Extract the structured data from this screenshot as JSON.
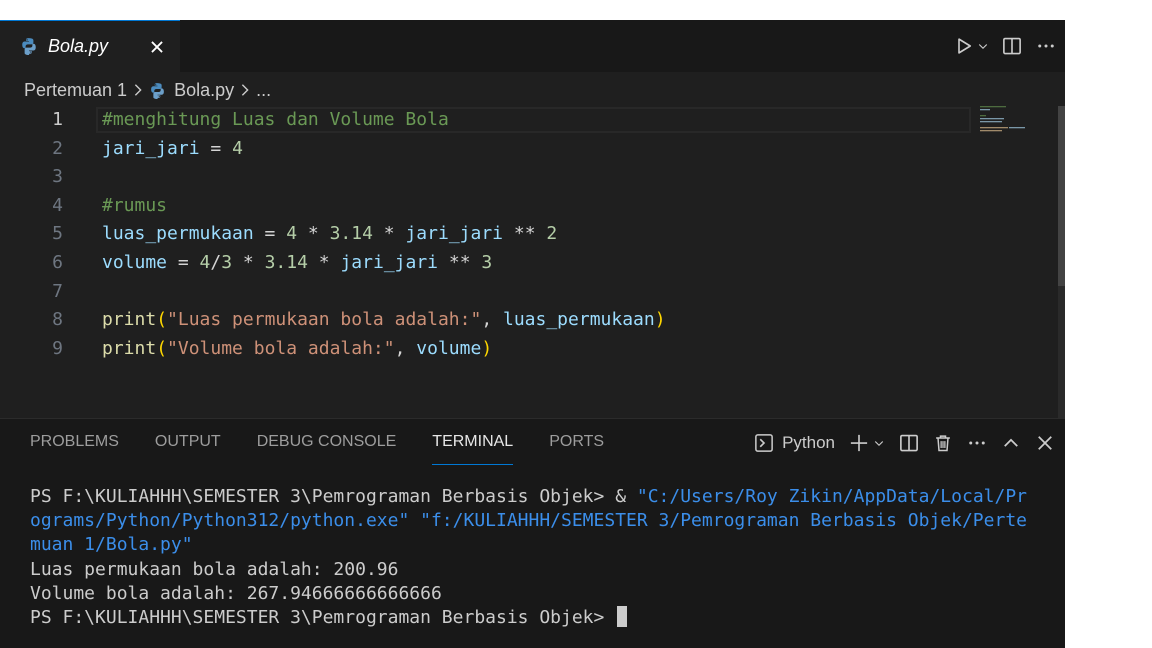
{
  "tab": {
    "filename": "Bola.py",
    "close_icon": "close-icon"
  },
  "breadcrumb": {
    "folder": "Pertemuan 1",
    "file": "Bola.py",
    "more": "..."
  },
  "editor": {
    "lines": [
      {
        "n": "1",
        "tokens": [
          {
            "t": "#menghitung Luas dan Volume Bola",
            "c": "cm"
          }
        ]
      },
      {
        "n": "2",
        "tokens": [
          {
            "t": "jari_jari",
            "c": "var"
          },
          {
            "t": " = ",
            "c": "op"
          },
          {
            "t": "4",
            "c": "num"
          }
        ]
      },
      {
        "n": "3",
        "tokens": []
      },
      {
        "n": "4",
        "tokens": [
          {
            "t": "#rumus",
            "c": "cm"
          }
        ]
      },
      {
        "n": "5",
        "tokens": [
          {
            "t": "luas_permukaan",
            "c": "var"
          },
          {
            "t": " = ",
            "c": "op"
          },
          {
            "t": "4",
            "c": "num"
          },
          {
            "t": " * ",
            "c": "op"
          },
          {
            "t": "3.14",
            "c": "num"
          },
          {
            "t": " * ",
            "c": "op"
          },
          {
            "t": "jari_jari",
            "c": "var"
          },
          {
            "t": " ** ",
            "c": "op"
          },
          {
            "t": "2",
            "c": "num"
          }
        ]
      },
      {
        "n": "6",
        "tokens": [
          {
            "t": "volume",
            "c": "var"
          },
          {
            "t": " = ",
            "c": "op"
          },
          {
            "t": "4",
            "c": "num"
          },
          {
            "t": "/",
            "c": "op"
          },
          {
            "t": "3",
            "c": "num"
          },
          {
            "t": " * ",
            "c": "op"
          },
          {
            "t": "3.14",
            "c": "num"
          },
          {
            "t": " * ",
            "c": "op"
          },
          {
            "t": "jari_jari",
            "c": "var"
          },
          {
            "t": " ** ",
            "c": "op"
          },
          {
            "t": "3",
            "c": "num"
          }
        ]
      },
      {
        "n": "7",
        "tokens": []
      },
      {
        "n": "8",
        "tokens": [
          {
            "t": "print",
            "c": "fn"
          },
          {
            "t": "(",
            "c": "br1"
          },
          {
            "t": "\"Luas permukaan bola adalah:\"",
            "c": "str"
          },
          {
            "t": ", ",
            "c": "op"
          },
          {
            "t": "luas_permukaan",
            "c": "var"
          },
          {
            "t": ")",
            "c": "br1"
          }
        ]
      },
      {
        "n": "9",
        "tokens": [
          {
            "t": "print",
            "c": "fn"
          },
          {
            "t": "(",
            "c": "br1"
          },
          {
            "t": "\"Volume bola adalah:\"",
            "c": "str"
          },
          {
            "t": ", ",
            "c": "op"
          },
          {
            "t": "volume",
            "c": "var"
          },
          {
            "t": ")",
            "c": "br1"
          }
        ]
      }
    ],
    "active_line": "1"
  },
  "panel": {
    "tabs": [
      "PROBLEMS",
      "OUTPUT",
      "DEBUG CONSOLE",
      "TERMINAL",
      "PORTS"
    ],
    "active_tab": "TERMINAL",
    "terminal_label": "Python"
  },
  "terminal": {
    "rows": [
      [
        {
          "t": "PS F:\\KULIAHHH\\SEMESTER 3\\Pemrograman Berbasis Objek> & ",
          "c": ""
        },
        {
          "t": "\"C:/Users/Roy Zikin/AppData/Local/Pr",
          "c": "path"
        }
      ],
      [
        {
          "t": "ograms/Python/Python312/python.exe\" \"f:/KULIAHHH/SEMESTER 3/Pemrograman Berbasis Objek/Perte",
          "c": "path"
        }
      ],
      [
        {
          "t": "muan 1/Bola.py\"",
          "c": "path"
        }
      ],
      [
        {
          "t": "Luas permukaan bola adalah: 200.96",
          "c": ""
        }
      ],
      [
        {
          "t": "Volume bola adalah: 267.94666666666666",
          "c": ""
        }
      ],
      [
        {
          "t": "PS F:\\KULIAHHH\\SEMESTER 3\\Pemrograman Berbasis Objek> ",
          "c": ""
        }
      ]
    ]
  },
  "colors": {
    "accent": "#0078d4",
    "background": "#1f1f1f",
    "panel": "#181818"
  }
}
